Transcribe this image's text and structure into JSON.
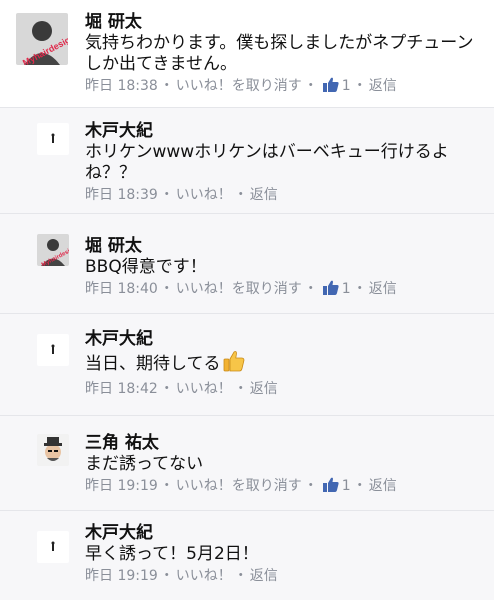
{
  "comments": [
    {
      "author": "堀 研太",
      "text": "気持ちわかります。僕も探しましたがネプチューンしか出てきません。",
      "time": "昨日 18:38",
      "like_action": "いいね！を取り消す",
      "like_count": "1",
      "reply": "返信",
      "avatar": "myhairdesign-avatar",
      "liked": true
    },
    {
      "author": "木戸大紀",
      "text": "ホリケンwwwホリケンはバーベキュー行けるよね？？",
      "time": "昨日 18:39",
      "like_action": "いいね！",
      "reply": "返信",
      "avatar": "small-figure-avatar",
      "liked": false
    },
    {
      "author": "堀 研太",
      "text": "BBQ得意です！",
      "time": "昨日 18:40",
      "like_action": "いいね！を取り消す",
      "like_count": "1",
      "reply": "返信",
      "avatar": "myhairdesign-avatar",
      "liked": true
    },
    {
      "author": "木戸大紀",
      "text": "当日、期待してる",
      "time": "昨日 18:42",
      "like_action": "いいね！",
      "reply": "返信",
      "avatar": "small-figure-avatar",
      "liked": false,
      "emoji": "thumbs-up-emoji"
    },
    {
      "author": "三角 祐太",
      "text": "まだ誘ってない",
      "time": "昨日 19:19",
      "like_action": "いいね！を取り消す",
      "like_count": "1",
      "reply": "返信",
      "avatar": "person-with-hat-avatar",
      "liked": true
    },
    {
      "author": "木戸大紀",
      "text": "早く誘って！5月2日！",
      "time": "昨日 19:19",
      "like_action": "いいね！",
      "reply": "返信",
      "avatar": "small-figure-avatar",
      "liked": false
    }
  ],
  "separator": "・",
  "colors": {
    "meta": "#8a8f99",
    "like_blue": "#4267b2",
    "reply_bg": "#f7f7f9"
  },
  "avatar_watermark": "Myhairdesign"
}
